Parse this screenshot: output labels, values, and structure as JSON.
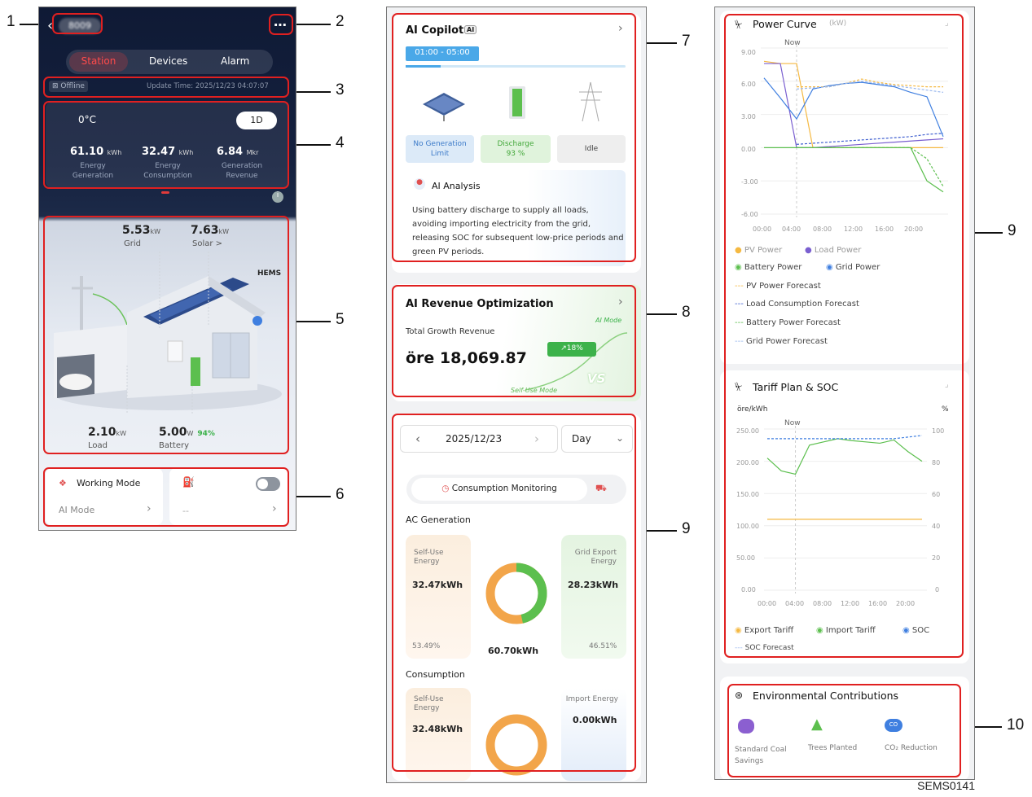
{
  "figure_id": "SEMS0141",
  "callouts": [
    "1",
    "2",
    "3",
    "4",
    "5",
    "6",
    "7",
    "8",
    "9",
    "9",
    "10"
  ],
  "station_screen": {
    "station_name": "8009",
    "more_icon": "more-dots-icon",
    "tabs": [
      "Station",
      "Devices",
      "Alarm"
    ],
    "active_tab": "Station",
    "status": "Offline",
    "update_time": "Update Time: 2025/12/23 04:07:07",
    "temperature": "0°C",
    "range_toggle": "1D",
    "stats": [
      {
        "value": "61.10",
        "unit": "kWh",
        "label1": "Energy",
        "label2": "Generation"
      },
      {
        "value": "32.47",
        "unit": "kWh",
        "label1": "Energy",
        "label2": "Consumption"
      },
      {
        "value": "6.84",
        "unit": "Mkr",
        "label1": "Generation",
        "label2": "Revenue"
      }
    ],
    "flow": {
      "grid_value": "5.53",
      "grid_unit": "kW",
      "grid_label": "Grid",
      "solar_value": "7.63",
      "solar_unit": "kW",
      "solar_label": "Solar >",
      "hems": "HEMS",
      "load_value": "2.10",
      "load_unit": "kW",
      "load_label": "Load",
      "battery_value": "5.00",
      "battery_unit": "W",
      "battery_soc": "94%",
      "battery_label": "Battery"
    },
    "working_mode": {
      "title": "Working Mode",
      "value": "AI Mode",
      "right_value": "--"
    }
  },
  "copilot_screen": {
    "copilot": {
      "title": "AI Copilot",
      "badge": "AI",
      "time_slot": "01:00 - 05:00",
      "modes": [
        {
          "label1": "No Generation",
          "label2": "Limit"
        },
        {
          "label1": "Discharge",
          "label2": "93 %"
        },
        {
          "label1": "Idle",
          "label2": ""
        }
      ],
      "analysis_title": "AI Analysis",
      "analysis_text": "Using battery discharge to supply all loads, avoiding importing electricity from the grid, releasing SOC for subsequent low-price periods and green PV periods."
    },
    "revenue": {
      "title": "AI Revenue Optimization",
      "label": "Total Growth Revenue",
      "value": "öre 18,069.87",
      "ai_mode": "AI Mode",
      "growth": "↗18%",
      "vs": "VS",
      "self_use": "Self-Use Mode"
    },
    "date_bar": {
      "date": "2025/12/23",
      "period": "Day"
    },
    "consumption_tab": "Consumption Monitoring",
    "ac_generation": {
      "title": "AC Generation",
      "left_label1": "Self-Use",
      "left_label2": "Energy",
      "left_value": "32.47kWh",
      "left_pct": "53.49%",
      "right_label1": "Grid Export",
      "right_label2": "Energy",
      "right_value": "28.23kWh",
      "right_pct": "46.51%",
      "total": "60.70kWh"
    },
    "consumption": {
      "title": "Consumption",
      "left_label1": "Self-Use",
      "left_label2": "Energy",
      "left_value": "32.48kWh",
      "right_label1": "Import Energy",
      "right_value": "0.00kWh"
    }
  },
  "charts_screen": {
    "power_curve": {
      "title": "Power Curve",
      "unit": "(kW)",
      "now": "Now",
      "yticks": [
        "9.00",
        "6.00",
        "3.00",
        "0.00",
        "-3.00",
        "-6.00"
      ],
      "xticks": [
        "00:00",
        "04:00",
        "08:00",
        "12:00",
        "16:00",
        "20:00"
      ],
      "legend": [
        "PV Power",
        "Load Power",
        "Battery Power",
        "Grid Power",
        "PV Power Forecast",
        "Load Consumption Forecast",
        "Battery Power Forecast",
        "Grid Power Forecast"
      ],
      "colors": {
        "pv": "#f5b942",
        "load": "#7a5fd0",
        "battery": "#5cbf4e",
        "grid": "#3f7fe0"
      }
    },
    "tariff": {
      "title": "Tariff Plan & SOC",
      "left_unit": "öre/kWh",
      "right_unit": "%",
      "now": "Now",
      "yticks": [
        "250.00",
        "200.00",
        "150.00",
        "100.00",
        "50.00",
        "0.00"
      ],
      "rticks": [
        "100",
        "80",
        "60",
        "40",
        "20",
        "0"
      ],
      "xticks": [
        "00:00",
        "04:00",
        "08:00",
        "12:00",
        "16:00",
        "20:00"
      ],
      "legend": [
        "Export Tariff",
        "Import Tariff",
        "SOC",
        "SOC Forecast"
      ]
    },
    "environment": {
      "title": "Environmental Contributions",
      "items": [
        {
          "icon": "coal-icon",
          "label1": "Standard Coal",
          "label2": "Savings"
        },
        {
          "icon": "tree-icon",
          "label1": "Trees Planted",
          "label2": ""
        },
        {
          "icon": "co2-cloud-icon",
          "label1": "CO₂ Reduction",
          "label2": ""
        }
      ]
    }
  },
  "chart_data": [
    {
      "type": "line",
      "title": "Power Curve",
      "ylabel": "kW",
      "ylim": [
        -6,
        9
      ],
      "x": [
        "00:00",
        "02:00",
        "04:00",
        "06:00",
        "08:00",
        "10:00",
        "12:00",
        "14:00",
        "16:00",
        "18:00",
        "20:00",
        "22:00"
      ],
      "series": [
        {
          "name": "PV Power",
          "values": [
            7.8,
            7.6,
            7.6,
            0,
            0,
            0,
            0,
            0,
            0,
            0,
            0,
            0
          ]
        },
        {
          "name": "Load Power",
          "values": [
            7.6,
            7.6,
            0,
            0,
            0.1,
            0.2,
            0.3,
            0.4,
            0.5,
            0.6,
            0.7,
            0.8
          ]
        },
        {
          "name": "Battery Power",
          "values": [
            0,
            0,
            0,
            0,
            0,
            0,
            0,
            0,
            0,
            0,
            -3,
            -4
          ]
        },
        {
          "name": "Grid Power",
          "values": [
            6.3,
            4.5,
            2.6,
            5.3,
            5.6,
            5.8,
            5.9,
            5.7,
            5.5,
            5.0,
            4.6,
            1.0
          ]
        },
        {
          "name": "PV Power Forecast",
          "values": [
            null,
            null,
            5.5,
            5.5,
            5.5,
            5.8,
            6.2,
            5.9,
            5.7,
            5.6,
            5.5,
            5.5
          ]
        },
        {
          "name": "Load Consumption Forecast",
          "values": [
            null,
            null,
            0.3,
            0.4,
            0.5,
            0.6,
            0.7,
            0.8,
            0.9,
            1.0,
            1.2,
            1.3
          ]
        },
        {
          "name": "Battery Power Forecast",
          "values": [
            null,
            null,
            0,
            0,
            0,
            0,
            0,
            0,
            0,
            0,
            -1,
            -3.5
          ]
        },
        {
          "name": "Grid Power Forecast",
          "values": [
            null,
            null,
            5.3,
            5.4,
            5.5,
            5.8,
            6.0,
            5.8,
            5.6,
            5.4,
            5.2,
            5.0
          ]
        }
      ]
    },
    {
      "type": "line",
      "title": "Tariff Plan & SOC",
      "ylabel": "öre/kWh",
      "ylim": [
        0,
        250
      ],
      "x": [
        "00:00",
        "02:00",
        "04:00",
        "06:00",
        "08:00",
        "10:00",
        "12:00",
        "14:00",
        "16:00",
        "18:00",
        "20:00",
        "22:00"
      ],
      "series": [
        {
          "name": "Export Tariff",
          "values": [
            110,
            110,
            110,
            110,
            110,
            110,
            110,
            110,
            110,
            110,
            110,
            110
          ]
        },
        {
          "name": "Import Tariff",
          "values": [
            205,
            185,
            180,
            225,
            230,
            235,
            232,
            230,
            228,
            233,
            215,
            200
          ]
        },
        {
          "name": "SOC",
          "values": [
            94,
            94,
            94,
            94,
            94,
            94,
            94,
            94,
            94,
            94,
            95,
            96
          ]
        },
        {
          "name": "SOC Forecast",
          "values": [
            null,
            null,
            null,
            null,
            null,
            null,
            null,
            null,
            null,
            null,
            null,
            null
          ]
        }
      ]
    }
  ]
}
